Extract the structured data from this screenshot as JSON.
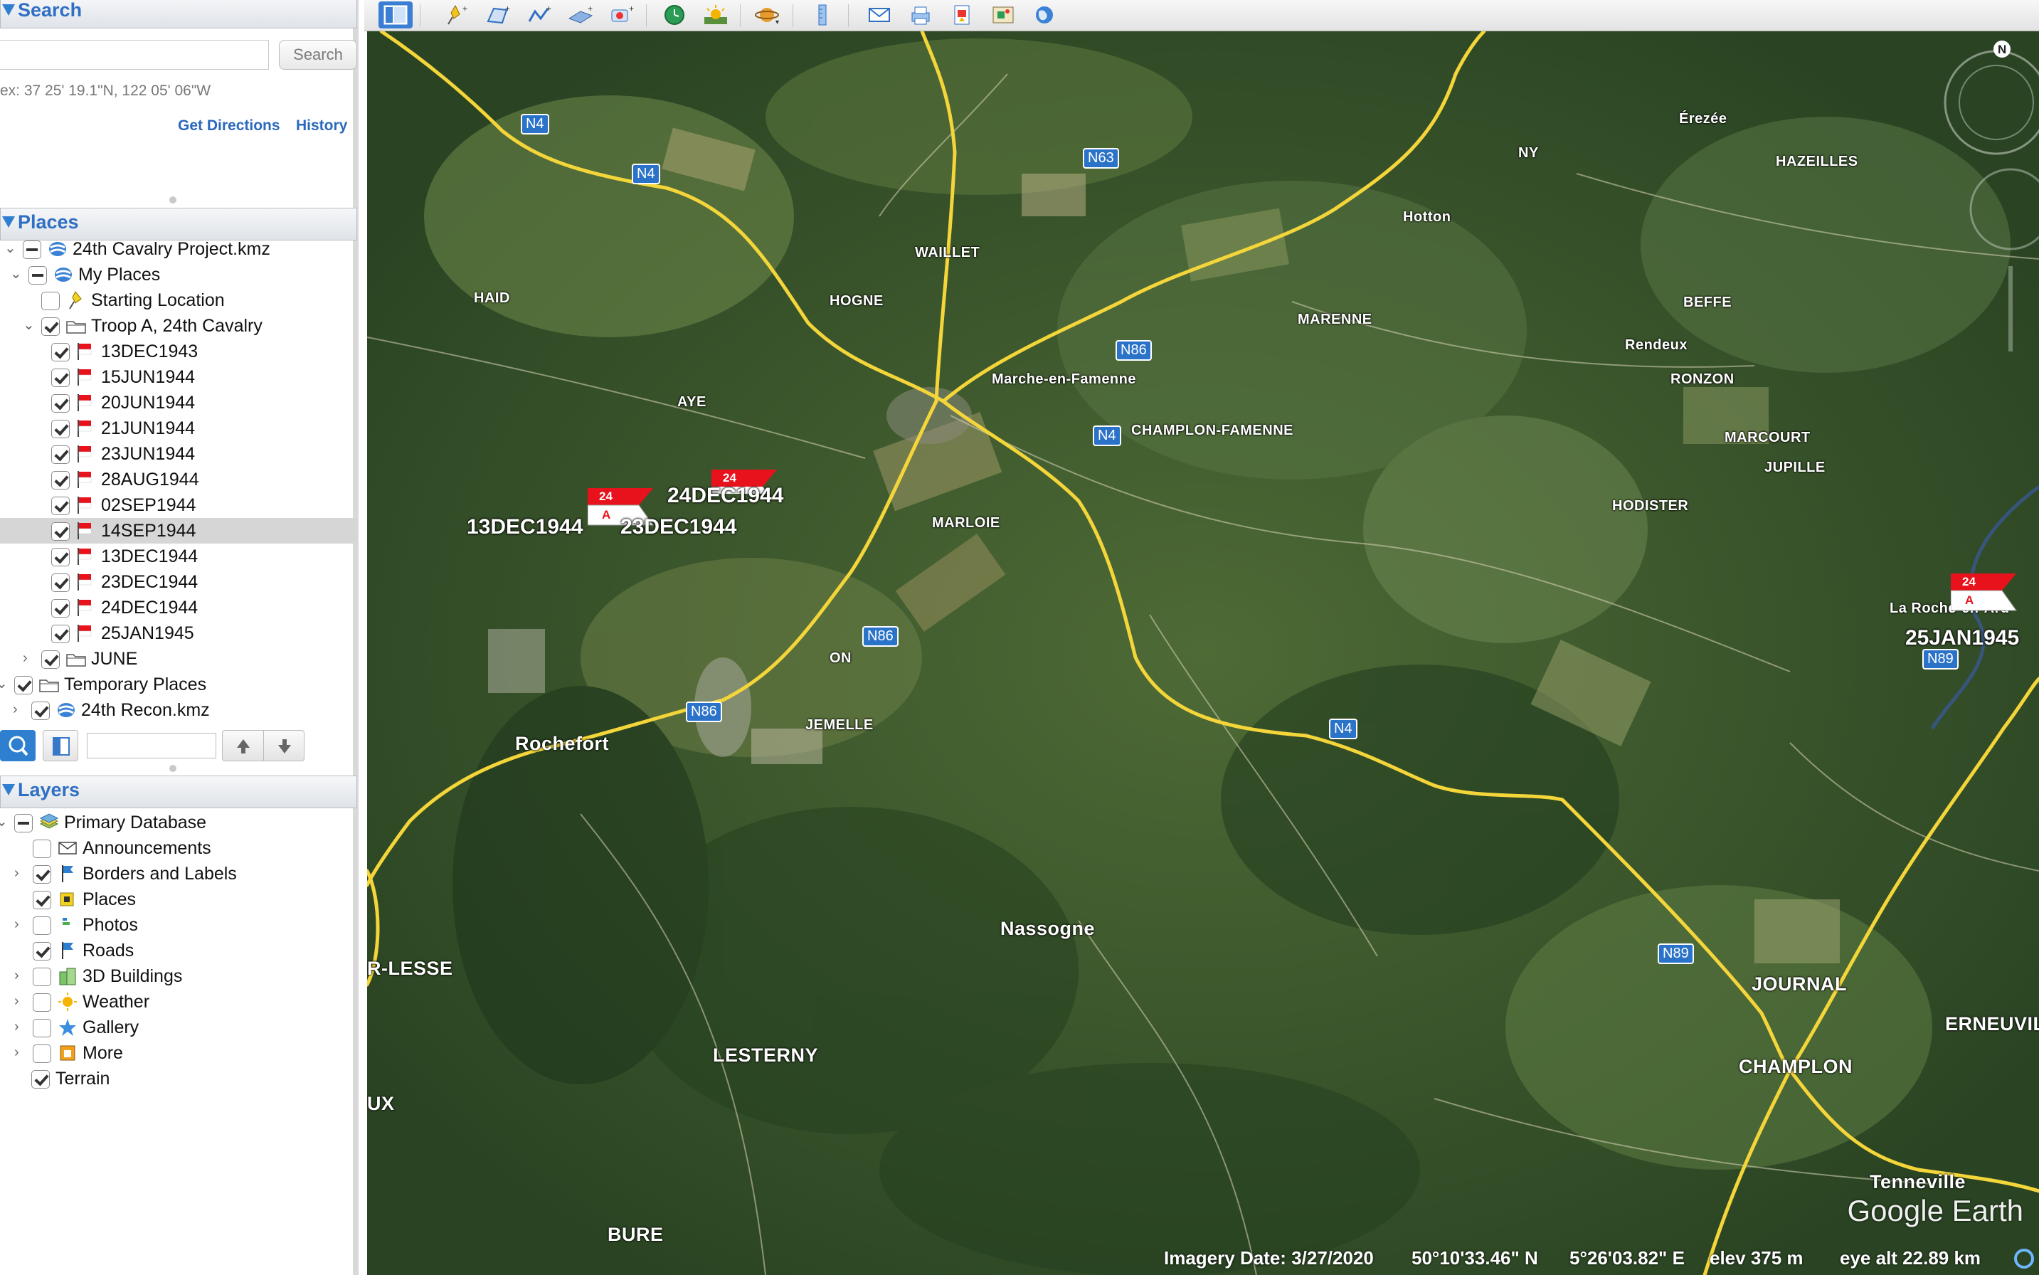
{
  "search": {
    "title": "Search",
    "input_value": "",
    "button_label": "Search",
    "hint": "ex: 37 25' 19.1\"N, 122 05' 06\"W",
    "get_directions": "Get Directions",
    "history": "History"
  },
  "places": {
    "title": "Places",
    "items": [
      {
        "label": "24th Cavalry Project.kmz",
        "level": 1,
        "check": "partial",
        "icon": "kmz-icon",
        "expanded": true
      },
      {
        "label": "My Places",
        "level": 2,
        "check": "partial",
        "icon": "globe-icon",
        "expanded": true
      },
      {
        "label": "Starting Location",
        "level": 3,
        "check": "off",
        "icon": "pushpin-icon"
      },
      {
        "label": "Troop A, 24th Cavalry",
        "level": 3,
        "check": "on",
        "icon": "folder-icon",
        "expanded": true
      },
      {
        "label": "13DEC1943",
        "level": 4,
        "check": "on",
        "icon": "flag-icon"
      },
      {
        "label": "15JUN1944",
        "level": 4,
        "check": "on",
        "icon": "flag-icon"
      },
      {
        "label": "20JUN1944",
        "level": 4,
        "check": "on",
        "icon": "flag-icon"
      },
      {
        "label": "21JUN1944",
        "level": 4,
        "check": "on",
        "icon": "flag-icon"
      },
      {
        "label": "23JUN1944",
        "level": 4,
        "check": "on",
        "icon": "flag-icon"
      },
      {
        "label": "28AUG1944",
        "level": 4,
        "check": "on",
        "icon": "flag-icon"
      },
      {
        "label": "02SEP1944",
        "level": 4,
        "check": "on",
        "icon": "flag-icon"
      },
      {
        "label": "14SEP1944",
        "level": 4,
        "check": "on",
        "icon": "flag-icon",
        "selected": true
      },
      {
        "label": "13DEC1944",
        "level": 4,
        "check": "on",
        "icon": "flag-icon"
      },
      {
        "label": "23DEC1944",
        "level": 4,
        "check": "on",
        "icon": "flag-icon"
      },
      {
        "label": "24DEC1944",
        "level": 4,
        "check": "on",
        "icon": "flag-icon"
      },
      {
        "label": "25JAN1945",
        "level": 4,
        "check": "on",
        "icon": "flag-icon"
      },
      {
        "label": "JUNE",
        "level": 3,
        "check": "on",
        "icon": "folder-icon",
        "expanded": false
      },
      {
        "label": "Temporary Places",
        "level": 1,
        "check": "on",
        "icon": "folder-icon",
        "expanded": true
      },
      {
        "label": "24th Recon.kmz",
        "level": 2,
        "check": "on",
        "icon": "kmz-icon",
        "expanded": false
      }
    ]
  },
  "layers": {
    "title": "Layers",
    "items": [
      {
        "label": "Primary Database",
        "level": 1,
        "check": "partial",
        "icon": "database-icon",
        "expanded": true
      },
      {
        "label": "Announcements",
        "level": 2,
        "check": "off",
        "icon": "envelope-icon"
      },
      {
        "label": "Borders and Labels",
        "level": 2,
        "check": "on",
        "icon": "flag-pole-icon",
        "expandable": true
      },
      {
        "label": "Places",
        "level": 2,
        "check": "on",
        "icon": "places-icon"
      },
      {
        "label": "Photos",
        "level": 2,
        "check": "off",
        "icon": "photos-icon",
        "expandable": true
      },
      {
        "label": "Roads",
        "level": 2,
        "check": "on",
        "icon": "roads-icon"
      },
      {
        "label": "3D Buildings",
        "level": 2,
        "check": "off",
        "icon": "buildings-icon",
        "expandable": true
      },
      {
        "label": "Weather",
        "level": 2,
        "check": "off",
        "icon": "weather-icon",
        "expandable": true
      },
      {
        "label": "Gallery",
        "level": 2,
        "check": "off",
        "icon": "star-icon",
        "expandable": true
      },
      {
        "label": "More",
        "level": 2,
        "check": "off",
        "icon": "more-icon",
        "expandable": true
      },
      {
        "label": "Terrain",
        "level": 1,
        "check": "on",
        "icon": ""
      }
    ]
  },
  "map": {
    "towns": [
      {
        "name": "WAILLET",
        "big": false
      },
      {
        "name": "HOGNE",
        "big": false
      },
      {
        "name": "HAID",
        "big": false
      },
      {
        "name": "AYE",
        "big": false
      },
      {
        "name": "Marche-en-Famenne",
        "big": false
      },
      {
        "name": "CHAMPLON-FAMENNE",
        "big": false
      },
      {
        "name": "MARLOIE",
        "big": false
      },
      {
        "name": "MARENNE",
        "big": false
      },
      {
        "name": "Hotton",
        "big": false
      },
      {
        "name": "NY",
        "big": false
      },
      {
        "name": "Érezée",
        "big": false
      },
      {
        "name": "HAZEILLES",
        "big": false
      },
      {
        "name": "BEFFE",
        "big": false
      },
      {
        "name": "Rendeux",
        "big": false
      },
      {
        "name": "RONZON",
        "big": false
      },
      {
        "name": "MARCOURT",
        "big": false
      },
      {
        "name": "JUPILLE",
        "big": false
      },
      {
        "name": "HODISTER",
        "big": false
      },
      {
        "name": "La Roche-en-Ard",
        "big": false
      },
      {
        "name": "ON",
        "big": false
      },
      {
        "name": "JEMELLE",
        "big": false
      },
      {
        "name": "Rochefort",
        "big": true
      },
      {
        "name": "Nassogne",
        "big": true
      },
      {
        "name": "R-LESSE",
        "big": true
      },
      {
        "name": "LESTERNY",
        "big": true
      },
      {
        "name": "UX",
        "big": true
      },
      {
        "name": "BURE",
        "big": true
      },
      {
        "name": "JOURNAL",
        "big": true
      },
      {
        "name": "ERNEUVILLE",
        "big": true
      },
      {
        "name": "CHAMPLON",
        "big": true
      },
      {
        "name": "Tenneville",
        "big": true
      }
    ],
    "routes": [
      "N4",
      "N4",
      "N63",
      "N86",
      "N4",
      "N86",
      "N86",
      "N4",
      "N89",
      "N89"
    ],
    "placemarks": [
      {
        "label": "13DEC1944",
        "flag_top": "24",
        "flag_bottom": "A"
      },
      {
        "label": "23DEC1944"
      },
      {
        "label": "24DEC1944",
        "flag_top": "24"
      },
      {
        "label": "25JAN1945",
        "flag_top": "24",
        "flag_bottom": "A"
      }
    ],
    "compass": "N"
  },
  "status": {
    "imagery_date": "Imagery Date: 3/27/2020",
    "lat": "50°10'33.46\" N",
    "lon": "5°26'03.82\" E",
    "elev": "elev   375 m",
    "eye_alt": "eye alt  22.89 km",
    "brand": "Google Earth"
  },
  "colors": {
    "accent": "#2f6fc4",
    "road": "#f4d53a",
    "route_badge": "#2b72c9",
    "flag_red": "#e8121c"
  }
}
